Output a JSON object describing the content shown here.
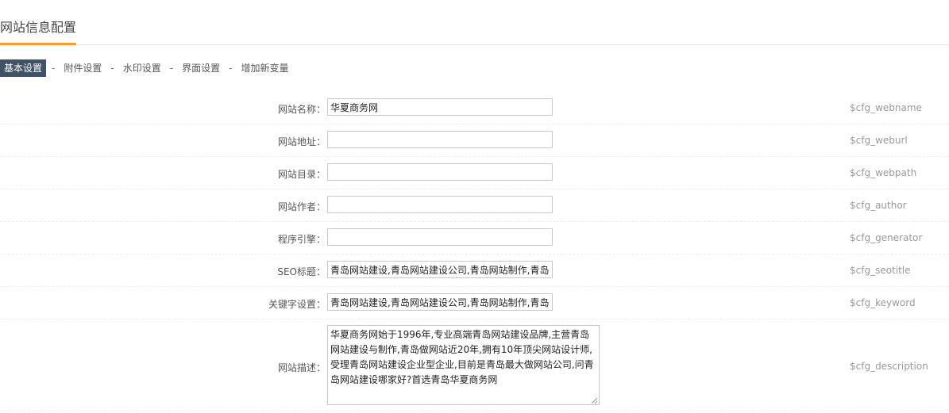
{
  "page": {
    "title": "网站信息配置"
  },
  "tabs": [
    {
      "label": "基本设置",
      "active": true
    },
    {
      "label": "附件设置"
    },
    {
      "label": "水印设置"
    },
    {
      "label": "界面设置"
    },
    {
      "label": "增加新变量"
    }
  ],
  "separator": "-",
  "fields": [
    {
      "label": "网站名称：",
      "value": "华夏商务网",
      "var": "$cfg_webname"
    },
    {
      "label": "网站地址：",
      "value": "",
      "var": "$cfg_weburl"
    },
    {
      "label": "网站目录：",
      "value": "",
      "var": "$cfg_webpath"
    },
    {
      "label": "网站作者：",
      "value": "",
      "var": "$cfg_author"
    },
    {
      "label": "程序引擎：",
      "value": "",
      "var": "$cfg_generator"
    },
    {
      "label": "SEO标题：",
      "value": "青岛网站建设,青岛网站建设公司,青岛网站制作,青岛",
      "var": "$cfg_seotitle"
    },
    {
      "label": "关键字设置：",
      "value": "青岛网站建设,青岛网站建设公司,青岛网站制作,青岛",
      "var": "$cfg_keyword"
    },
    {
      "label": "网站描述：",
      "value": "华夏商务网始于1996年,专业高端青岛网站建设品牌,主营青岛网站建设与制作,青岛做网站近20年,拥有10年顶尖网站设计师,受理青岛网站建设企业型企业,目前是青岛最大做网站公司,问青岛网站建设哪家好?首选青岛华夏商务网",
      "var": "$cfg_description"
    }
  ]
}
